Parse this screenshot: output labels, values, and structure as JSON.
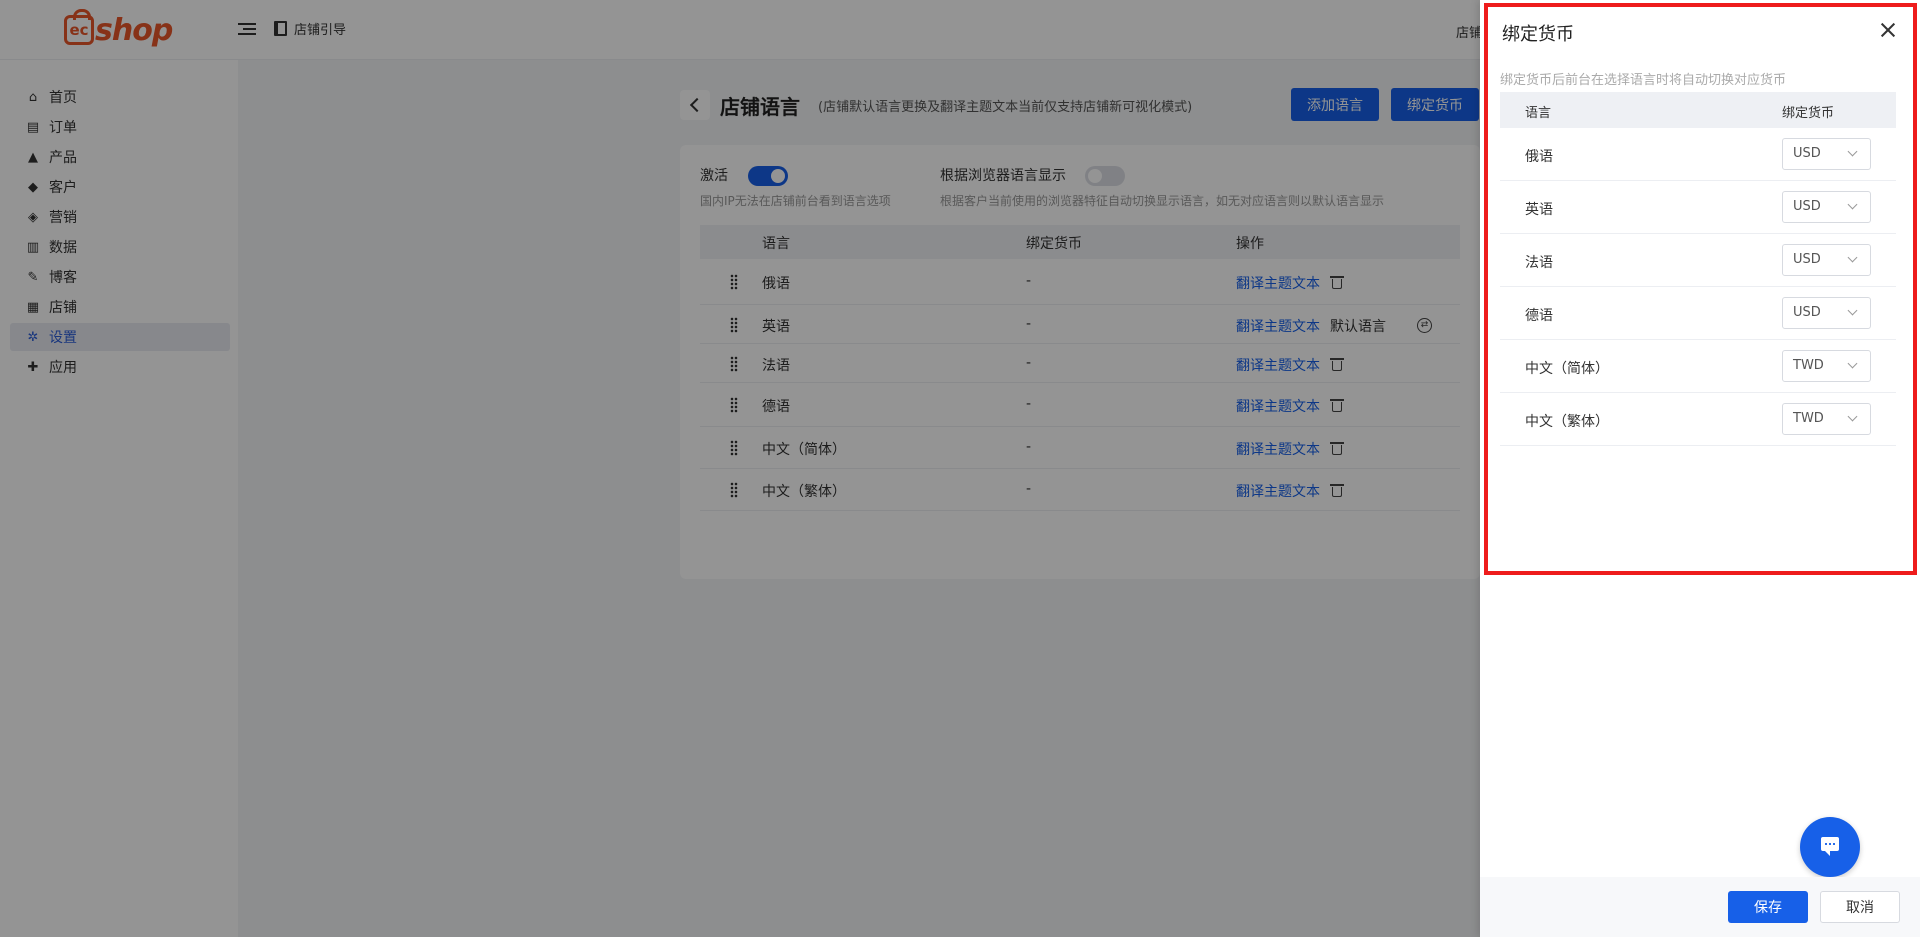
{
  "header": {
    "logo_text": "shop",
    "logo_badge": "ec",
    "guide_label": "店铺引导",
    "store_label": "店铺"
  },
  "sidebar": {
    "items": [
      {
        "label": "首页",
        "icon": "home-icon"
      },
      {
        "label": "订单",
        "icon": "clipboard-icon"
      },
      {
        "label": "产品",
        "icon": "bag-icon"
      },
      {
        "label": "客户",
        "icon": "diamond-icon"
      },
      {
        "label": "营销",
        "icon": "tag-icon"
      },
      {
        "label": "数据",
        "icon": "bar-chart-icon"
      },
      {
        "label": "博客",
        "icon": "edit-icon"
      },
      {
        "label": "店铺",
        "icon": "store-icon"
      },
      {
        "label": "设置",
        "icon": "gear-icon",
        "active": true
      },
      {
        "label": "应用",
        "icon": "puzzle-icon"
      }
    ]
  },
  "page": {
    "title": "店铺语言",
    "subtitle": "(店铺默认语言更换及翻译主题文本当前仅支持店铺新可视化模式)",
    "add_language_label": "添加语言",
    "bind_currency_label": "绑定货币",
    "activate_label": "激活",
    "activate_on": true,
    "activate_hint": "国内IP无法在店铺前台看到语言选项",
    "browser_label": "根据浏览器语言显示",
    "browser_on": false,
    "browser_hint": "根据客户当前使用的浏览器特征自动切换显示语言，如无对应语言则以默认语言显示",
    "table": {
      "headers": {
        "language": "语言",
        "currency": "绑定货币",
        "actions": "操作"
      },
      "rows": [
        {
          "language": "俄语",
          "currency": "-",
          "action": "翻译主题文本"
        },
        {
          "language": "英语",
          "currency": "-",
          "action": "翻译主题文本",
          "default_label": "默认语言"
        },
        {
          "language": "法语",
          "currency": "-",
          "action": "翻译主题文本"
        },
        {
          "language": "德语",
          "currency": "-",
          "action": "翻译主题文本"
        },
        {
          "language": "中文（简体）",
          "currency": "-",
          "action": "翻译主题文本"
        },
        {
          "language": "中文（繁体）",
          "currency": "-",
          "action": "翻译主题文本"
        }
      ]
    }
  },
  "drawer": {
    "title": "绑定货币",
    "hint": "绑定货币后前台在选择语言时将自动切换对应货币",
    "headers": {
      "language": "语言",
      "currency": "绑定货币"
    },
    "rows": [
      {
        "language": "俄语",
        "currency": "USD"
      },
      {
        "language": "英语",
        "currency": "USD"
      },
      {
        "language": "法语",
        "currency": "USD"
      },
      {
        "language": "德语",
        "currency": "USD"
      },
      {
        "language": "中文（简体）",
        "currency": "TWD"
      },
      {
        "language": "中文（繁体）",
        "currency": "TWD"
      }
    ],
    "save_label": "保存",
    "cancel_label": "取消"
  },
  "colors": {
    "primary": "#1760e8",
    "brand": "#e8562a",
    "highlight": "#ee1c1c"
  }
}
